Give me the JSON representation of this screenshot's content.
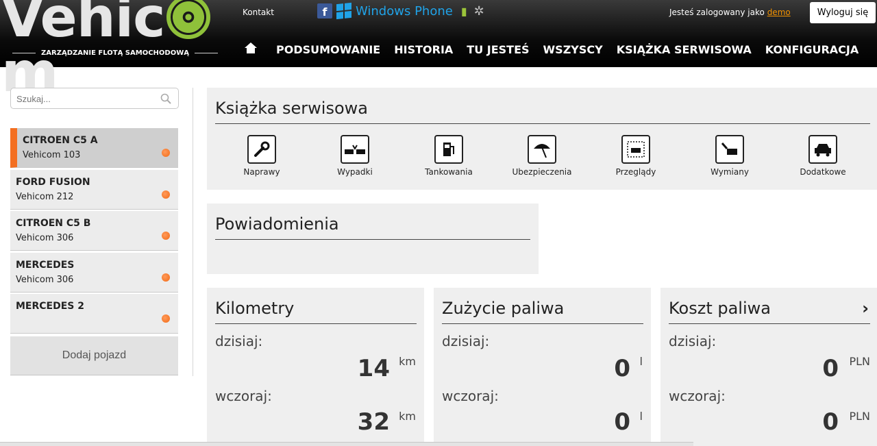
{
  "header": {
    "logo_word_start": "Vehic",
    "logo_word_end": "m",
    "logo_tagline": "ZARZĄDZANIE FLOTĄ SAMOCHODOWĄ",
    "kontakt": "Kontakt",
    "windows_phone": "Windows Phone",
    "logged_prefix": "Jesteś zalogowany jako",
    "user": "demo",
    "logout": "Wyloguj się"
  },
  "nav": {
    "items": [
      "PODSUMOWANIE",
      "HISTORIA",
      "TU JESTEŚ",
      "WSZYSCY",
      "KSIĄŻKA SERWISOWA",
      "KONFIGURACJA"
    ]
  },
  "sidebar": {
    "search_placeholder": "Szukaj...",
    "vehicles": [
      {
        "name": "CITROEN C5 A",
        "sub": "Vehicom 103",
        "active": true
      },
      {
        "name": "FORD FUSION",
        "sub": "Vehicom 212",
        "active": false
      },
      {
        "name": "CITROEN C5 B",
        "sub": "Vehicom 306",
        "active": false
      },
      {
        "name": "MERCEDES",
        "sub": "Vehicom 306",
        "active": false
      },
      {
        "name": "MERCEDES 2",
        "sub": "",
        "active": false
      }
    ],
    "add_vehicle": "Dodaj pojazd"
  },
  "service_book": {
    "title": "Książka serwisowa",
    "items": [
      {
        "label": "Naprawy",
        "icon": "wrench-icon"
      },
      {
        "label": "Wypadki",
        "icon": "crash-icon"
      },
      {
        "label": "Tankowania",
        "icon": "fuel-pump-icon"
      },
      {
        "label": "Ubezpieczenia",
        "icon": "umbrella-icon"
      },
      {
        "label": "Przeglądy",
        "icon": "inspection-icon"
      },
      {
        "label": "Wymiany",
        "icon": "car-hood-icon"
      },
      {
        "label": "Dodatkowe",
        "icon": "car-icon"
      }
    ]
  },
  "notifications": {
    "title": "Powiadomienia"
  },
  "stats": [
    {
      "title": "Kilometry",
      "today_label": "dzisiaj:",
      "today": "14",
      "yesterday_label": "wczoraj:",
      "yesterday": "32",
      "unit": "km"
    },
    {
      "title": "Zużycie paliwa",
      "today_label": "dzisiaj:",
      "today": "0",
      "yesterday_label": "wczoraj:",
      "yesterday": "0",
      "unit": "l"
    },
    {
      "title": "Koszt paliwa",
      "today_label": "dzisiaj:",
      "today": "0",
      "yesterday_label": "wczoraj:",
      "yesterday": "0",
      "unit": "PLN"
    }
  ],
  "colors": {
    "accent": "#f36f21",
    "brand_green": "#8fc13a",
    "windows_blue": "#20a3e8"
  }
}
